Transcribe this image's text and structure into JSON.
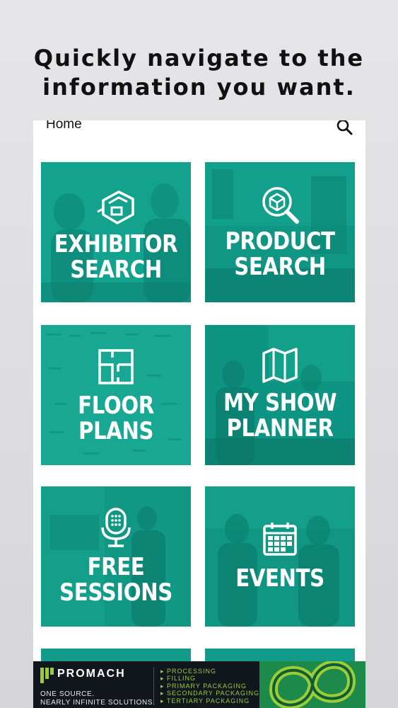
{
  "headline": {
    "line1": "Quickly navigate to the",
    "line2": "information you want."
  },
  "topbar": {
    "title": "Home",
    "icon": "search-icon"
  },
  "tiles": [
    {
      "label": "EXHIBITOR\nSEARCH",
      "icon": "booth-icon"
    },
    {
      "label": "PRODUCT\nSEARCH",
      "icon": "product-search-icon"
    },
    {
      "label": "FLOOR\nPLANS",
      "icon": "floor-plan-icon"
    },
    {
      "label": "MY SHOW\nPLANNER",
      "icon": "map-icon"
    },
    {
      "label": "FREE\nSESSIONS",
      "icon": "microphone-icon"
    },
    {
      "label": "EVENTS",
      "icon": "calendar-icon"
    }
  ],
  "ad": {
    "brand": "PROMACH",
    "tagline1": "ONE SOURCE.",
    "tagline2": "NEARLY INFINITE SOLUTIONS.",
    "items": [
      "PROCESSING",
      "FILLING",
      "PRIMARY PACKAGING",
      "SECONDARY PACKAGING",
      "TERTIARY PACKAGING"
    ]
  },
  "colors": {
    "tile_teal": "#119b88",
    "accent_green": "#9ccc3a",
    "ad_bg": "#12171d"
  }
}
